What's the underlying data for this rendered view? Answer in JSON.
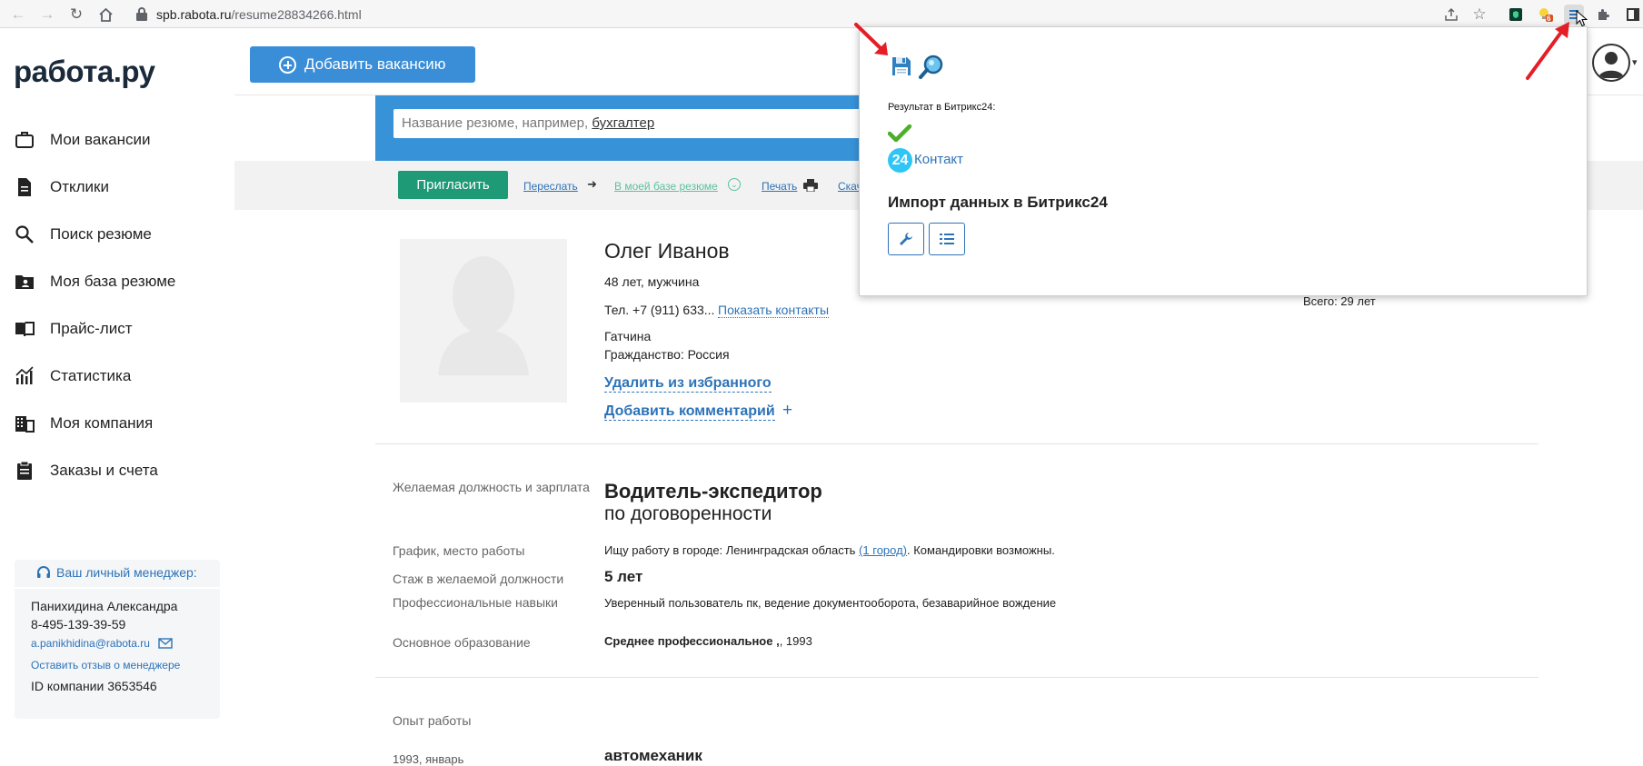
{
  "browser": {
    "url_host": "spb.rabota.ru",
    "url_path": "/resume28834266.html",
    "ext_badge": "6"
  },
  "site": {
    "logo": "работа.ру",
    "add_vacancy": "Добавить вакансию"
  },
  "sidebar": {
    "items": [
      {
        "label": "Мои вакансии",
        "icon": "briefcase-icon"
      },
      {
        "label": "Отклики",
        "icon": "document-icon"
      },
      {
        "label": "Поиск резюме",
        "icon": "search-icon"
      },
      {
        "label": "Моя база резюме",
        "icon": "folder-person-icon"
      },
      {
        "label": "Прайс-лист",
        "icon": "book-icon"
      },
      {
        "label": "Статистика",
        "icon": "stats-icon"
      },
      {
        "label": "Моя компания",
        "icon": "building-icon"
      },
      {
        "label": "Заказы и счета",
        "icon": "clipboard-icon"
      }
    ]
  },
  "manager": {
    "heading": "Ваш личный менеджер:",
    "name": "Панихидина Александра",
    "phone": "8-495-139-39-59",
    "email": "a.panikhidina@rabota.ru",
    "feedback": "Оставить отзыв о менеджере",
    "company_id": "ID компании 3653546"
  },
  "search": {
    "placeholder": "Название резюме, например,",
    "example": "бухгалтер"
  },
  "toolbar": {
    "invite": "Пригласить",
    "forward": "Переслать",
    "in_base": "В моей базе резюме",
    "print": "Печать",
    "download": "Скач"
  },
  "resume": {
    "name": "Олег Иванов",
    "age_gender": "48 лет, мужчина",
    "phone": "Тел. +7 (911) 633...",
    "show_contacts": "Показать контакты",
    "city": "Гатчина",
    "citizenship": "Гражданство: Россия",
    "remove_fav": "Удалить из избранного",
    "add_comment": "Добавить комментарий",
    "add_comment_plus": "+",
    "total": "Всего: 29 лет",
    "desired_label": "Желаемая должность и зарплата",
    "position": "Водитель-экспедитор",
    "salary": "по договоренности",
    "schedule_label": "График, место работы",
    "schedule_pre": "Ищу работу в городе: Ленинградская область",
    "schedule_link": "(1 город)",
    "schedule_post": ". Командировки возможны.",
    "exp_label": "Стаж в желаемой должности",
    "exp_value": "5 лет",
    "skills_label": "Профессиональные навыки",
    "skills_value": "Уверенный пользователь пк, ведение документооборота, безаварийное вождение",
    "edu_label": "Основное образование",
    "edu_value": "Среднее профессиональное ,",
    "edu_year": ", 1993",
    "work_label": "Опыт работы",
    "work_date": "1993, январь",
    "work_title": "автомеханик"
  },
  "popup": {
    "result_label": "Результат в Битрикс24:",
    "b24_badge": "24",
    "contact": "Контакт",
    "import_title": "Импорт данных в Битрикс24"
  },
  "colors": {
    "accent_blue": "#3a8ed8",
    "invite_green": "#1f9a76",
    "link_blue": "#2d73b8",
    "bitrix_cyan": "#2fc6f6",
    "annotation_red": "#e41e26"
  }
}
